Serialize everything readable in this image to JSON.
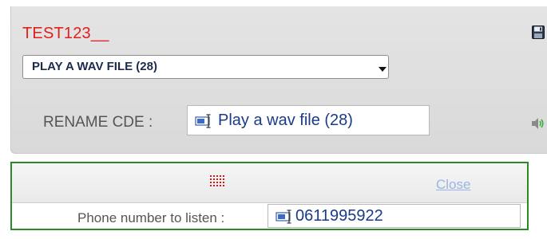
{
  "header": {
    "title": "TEST123__",
    "save_icon": "floppy-disk-icon"
  },
  "command_select": {
    "value": "PLAY A WAV FILE (28)",
    "arrow_icon": "dropdown-arrow-icon"
  },
  "rename": {
    "label": "RENAME CDE :",
    "value": "Play a wav file (28)",
    "field_icon": "text-cursor-field-icon",
    "audio_icon": "speaker-icon"
  },
  "listen_panel": {
    "handle_icon": "grid-dots-icon",
    "close_label": "Close",
    "phone_label": "Phone number to listen :",
    "phone_value": "0611995922",
    "field_icon": "text-cursor-field-icon"
  },
  "colors": {
    "title": "#e0201c",
    "panel_border": "#2a8a2a",
    "link": "#9bb4e6",
    "input_text": "#1a3a8a"
  }
}
